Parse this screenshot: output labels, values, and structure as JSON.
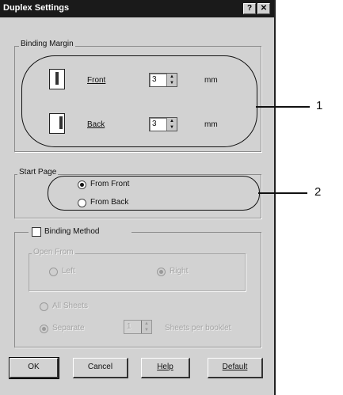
{
  "window": {
    "title": "Duplex Settings",
    "help_glyph": "?",
    "close_glyph": "✕"
  },
  "binding_margin": {
    "label": "Binding Margin",
    "front": {
      "label": "Front",
      "value": "3",
      "unit": "mm"
    },
    "back": {
      "label": "Back",
      "value": "3",
      "unit": "mm"
    }
  },
  "start_page": {
    "label": "Start Page",
    "options": [
      {
        "label": "From Front",
        "selected": true
      },
      {
        "label": "From Back",
        "selected": false
      }
    ]
  },
  "binding_method": {
    "label": "Binding Method",
    "checked": false,
    "open_from": {
      "label": "Open From",
      "left": "Left",
      "right": "Right",
      "right_selected": true
    },
    "all_sheets": "All Sheets",
    "separate": "Separate",
    "stepper_value": "1",
    "sheets_label": "Sheets per booklet"
  },
  "buttons": {
    "ok": "OK",
    "cancel": "Cancel",
    "help": "Help",
    "default": "Default"
  },
  "callouts": [
    "1",
    "2"
  ],
  "icons": [
    "help-icon",
    "close-icon",
    "page-front-icon",
    "page-back-icon",
    "spin-arrows-icon"
  ]
}
